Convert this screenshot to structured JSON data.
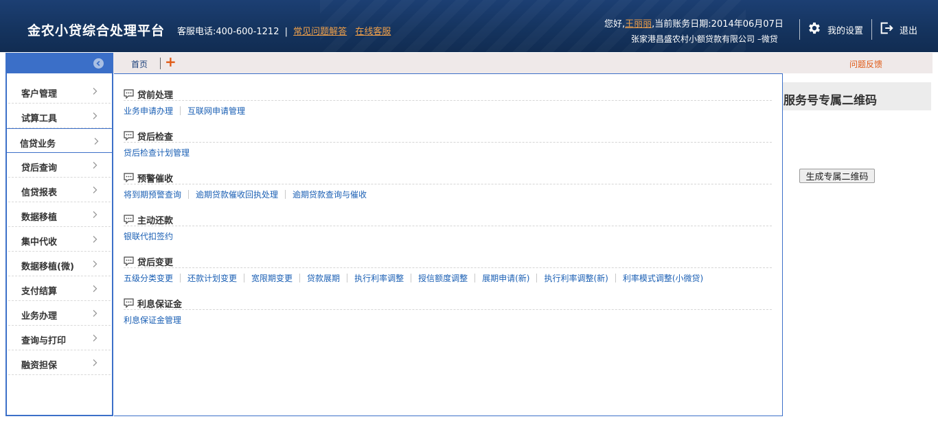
{
  "header": {
    "app_title": "金农小贷综合处理平台",
    "hotline": "客服电话:400-600-1212",
    "hotline_sep": "|",
    "faq_link": "常见问题解答",
    "online_service_link": "在线客服",
    "greeting_prefix": "您好,",
    "user_name": "王丽丽",
    "greeting_suffix": ",当前账务日期:2014年06月07日",
    "company": "张家港昌盛农村小额贷款有限公司 –微贷",
    "settings_label": "我的设置",
    "logout_label": "退出"
  },
  "tabs": {
    "home_label": "首页",
    "add_label": "+",
    "feedback_label": "问题反馈"
  },
  "sidebar": {
    "items": [
      {
        "label": "客户管理"
      },
      {
        "label": "试算工具"
      },
      {
        "label": "信贷业务"
      },
      {
        "label": "贷后查询"
      },
      {
        "label": "信贷报表"
      },
      {
        "label": "数据移植"
      },
      {
        "label": "集中代收"
      },
      {
        "label": "数据移植(微)"
      },
      {
        "label": "支付结算"
      },
      {
        "label": "业务办理"
      },
      {
        "label": "查询与打印"
      },
      {
        "label": "融资担保"
      }
    ],
    "active_index": 2
  },
  "main": {
    "sections": [
      {
        "title": "贷前处理",
        "links": [
          "业务申请办理",
          "互联网申请管理"
        ]
      },
      {
        "title": "贷后检查",
        "links": [
          "贷后检查计划管理"
        ]
      },
      {
        "title": "预警催收",
        "links": [
          "将到期预警查询",
          "逾期贷款催收回执处理",
          "逾期贷款查询与催收"
        ]
      },
      {
        "title": "主动还款",
        "links": [
          "银联代扣签约"
        ]
      },
      {
        "title": "贷后变更",
        "links": [
          "五级分类变更",
          "还款计划变更",
          "宽限期变更",
          "贷款展期",
          "执行利率调整",
          "授信额度调整",
          "展期申请(新)",
          "执行利率调整(新)",
          "利率模式调整(小微贷)"
        ]
      },
      {
        "title": "利息保证金",
        "links": [
          "利息保证金管理"
        ]
      }
    ]
  },
  "right_panel": {
    "title": "服务号专属二维码",
    "button_label": "生成专属二维码"
  },
  "colors": {
    "header_bg": "#15345f",
    "accent_blue": "#3b6fc8",
    "link_orange": "#f0a04a",
    "feedback_orange": "#e05a16",
    "link_blue": "#1a5fb4"
  },
  "icons": {
    "collapse": "chevron-left-circle-icon",
    "settings": "gear-icon",
    "logout": "logout-icon",
    "section": "comment-icon",
    "sidebar_item": "chevron-right-icon"
  }
}
